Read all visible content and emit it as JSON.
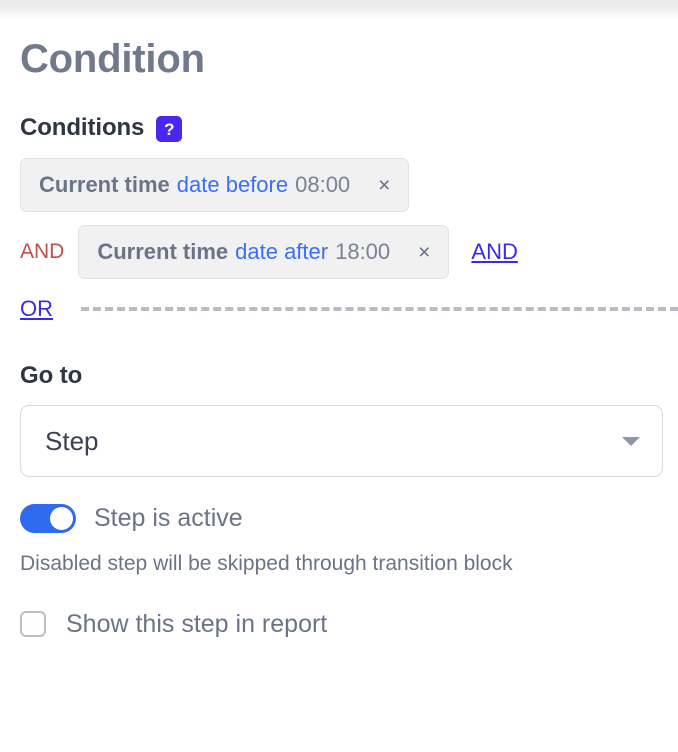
{
  "page": {
    "title": "Condition"
  },
  "conditions_section": {
    "label": "Conditions",
    "help_badge": "?",
    "rows": [
      {
        "operator_label": "",
        "chip": {
          "subject": "Current time",
          "operator": "date before",
          "value": "08:00",
          "remove": "×"
        },
        "trailing_link": ""
      },
      {
        "operator_label": "AND",
        "chip": {
          "subject": "Current time",
          "operator": "date after",
          "value": "18:00",
          "remove": "×"
        },
        "trailing_link": "AND"
      }
    ],
    "or_link": "OR"
  },
  "goto_section": {
    "label": "Go to",
    "selected": "Step",
    "caret_icon": "chevron-down-icon"
  },
  "step_active": {
    "label": "Step is active",
    "enabled": true,
    "helper_text": "Disabled step will be skipped through transition block"
  },
  "report_option": {
    "label": "Show this step in report",
    "checked": false
  },
  "colors": {
    "accent_indigo": "#4827f2",
    "link_indigo": "#3b2ae8",
    "operator_blue": "#3b6ff5",
    "and_red": "#c0504a",
    "toggle_blue": "#2f6bf0",
    "title_slate": "#717a8c",
    "text_slate": "#6b7486",
    "chip_bg": "#f1f1f2"
  }
}
